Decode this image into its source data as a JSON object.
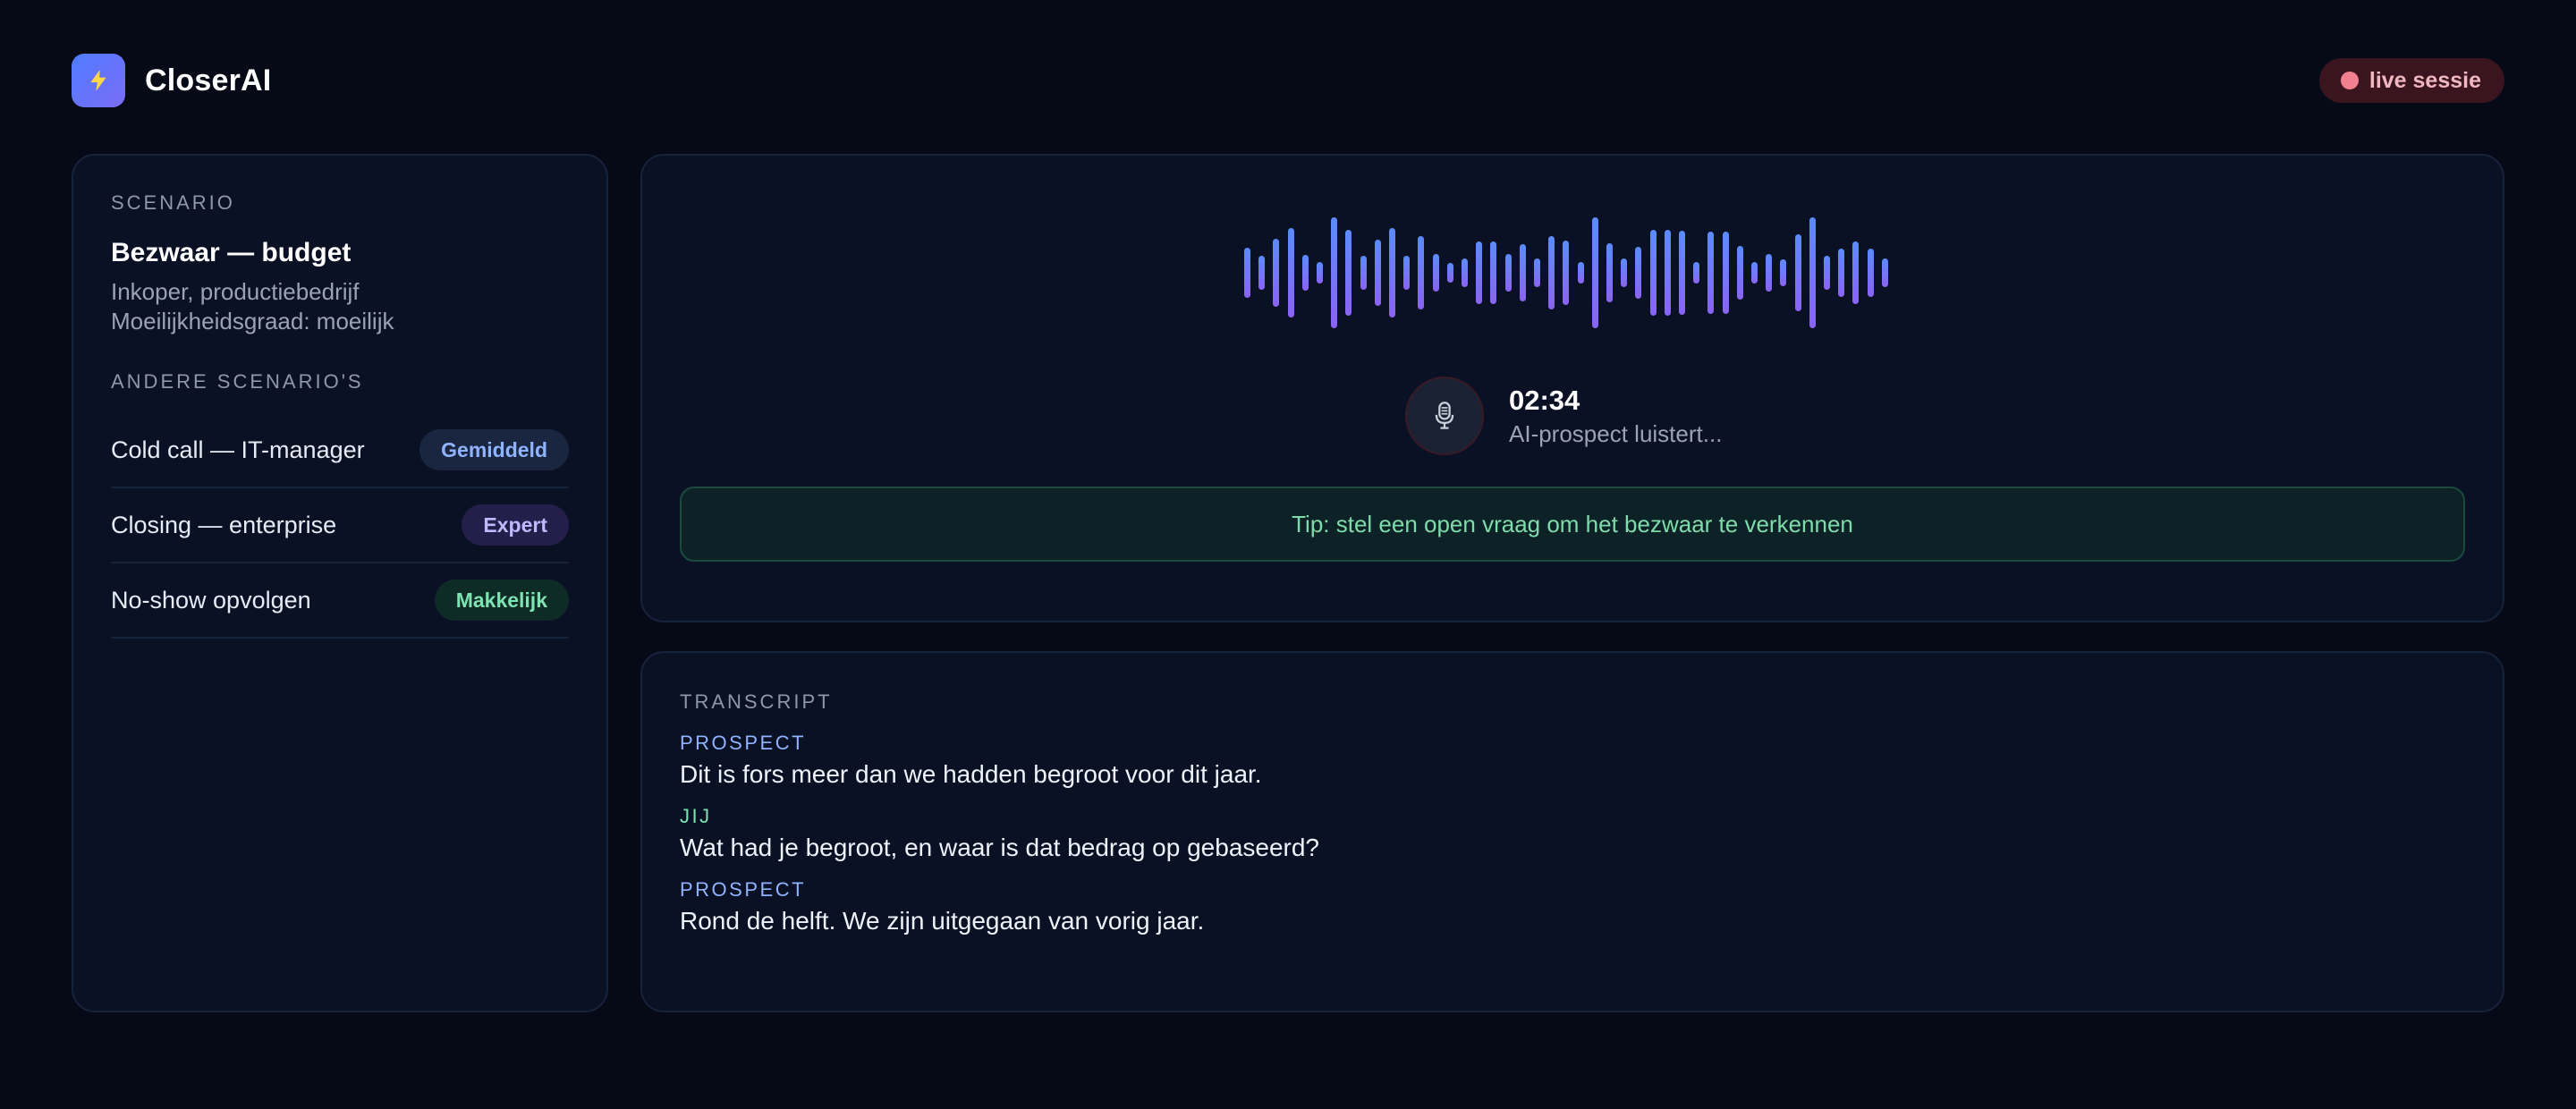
{
  "app": {
    "name": "CloserAI",
    "logo_icon": "lightning-icon",
    "accent": "#5b7cff"
  },
  "session": {
    "status_label": "live sessie",
    "status_color": "#f2808f"
  },
  "scenario": {
    "section_label": "SCENARIO",
    "title": "Bezwaar — budget",
    "persona": "Inkoper, productiebedrijf",
    "difficulty": "Moeilijkheidsgraad: moeilijk"
  },
  "other_scenarios": {
    "section_label": "ANDERE SCENARIO'S",
    "items": [
      {
        "name": "Cold call — IT-manager",
        "level": "Gemiddeld",
        "level_color": "#8fb3ff"
      },
      {
        "name": "Closing — enterprise",
        "level": "Expert",
        "level_color": "#c2b8ff"
      },
      {
        "name": "No-show opvolgen",
        "level": "Makkelijk",
        "level_color": "#7ee3b1"
      }
    ]
  },
  "call": {
    "timer": "02:34",
    "status": "AI-prospect luistert...",
    "mic_icon": "microphone-icon",
    "tip": "Tip: stel een open vraag om het bezwaar te verkennen",
    "waveform_levels": [
      0.45,
      0.3,
      0.62,
      0.8,
      0.32,
      0.2,
      1.0,
      0.78,
      0.3,
      0.6,
      0.8,
      0.3,
      0.66,
      0.34,
      0.18,
      0.26,
      0.56,
      0.56,
      0.34,
      0.52,
      0.26,
      0.66,
      0.58,
      0.2,
      1.0,
      0.54,
      0.26,
      0.46,
      0.78,
      0.78,
      0.76,
      0.2,
      0.74,
      0.74,
      0.48,
      0.2,
      0.34,
      0.24,
      0.7,
      1.0,
      0.3,
      0.44,
      0.56,
      0.44,
      0.26
    ]
  },
  "transcript": {
    "section_label": "TRANSCRIPT",
    "messages": [
      {
        "speaker": "PROSPECT",
        "text": "Dit is fors meer dan we hadden begroot voor dit jaar."
      },
      {
        "speaker": "JIJ",
        "text": "Wat had je begroot, en waar is dat bedrag op gebaseerd?"
      },
      {
        "speaker": "PROSPECT",
        "text": "Rond de helft. We zijn uitgegaan van vorig jaar."
      }
    ]
  }
}
